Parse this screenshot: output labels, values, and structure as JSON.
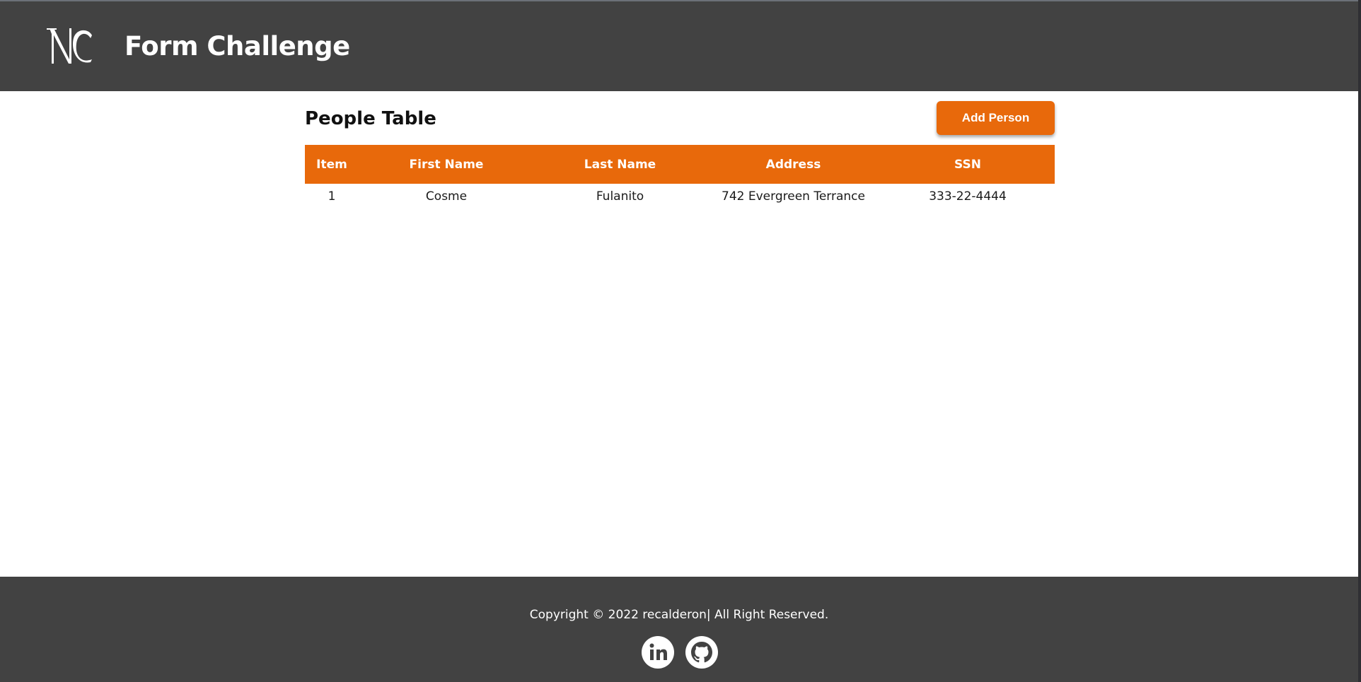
{
  "header": {
    "logo_text": "NC",
    "title": "Form Challenge"
  },
  "main": {
    "title": "People Table",
    "add_button_label": "Add Person",
    "table": {
      "columns": [
        "Item",
        "First Name",
        "Last Name",
        "Address",
        "SSN"
      ],
      "rows": [
        [
          "1",
          "Cosme",
          "Fulanito",
          "742 Evergreen Terrance",
          "333-22-4444"
        ]
      ]
    }
  },
  "footer": {
    "copyright": "Copyright © 2022 recalderon| All Right Reserved.",
    "social": [
      {
        "icon": "linkedin-icon"
      },
      {
        "icon": "github-icon"
      }
    ]
  },
  "colors": {
    "header_bg": "#424242",
    "accent": "#e8690b",
    "text_dark": "#111111",
    "white": "#ffffff"
  }
}
